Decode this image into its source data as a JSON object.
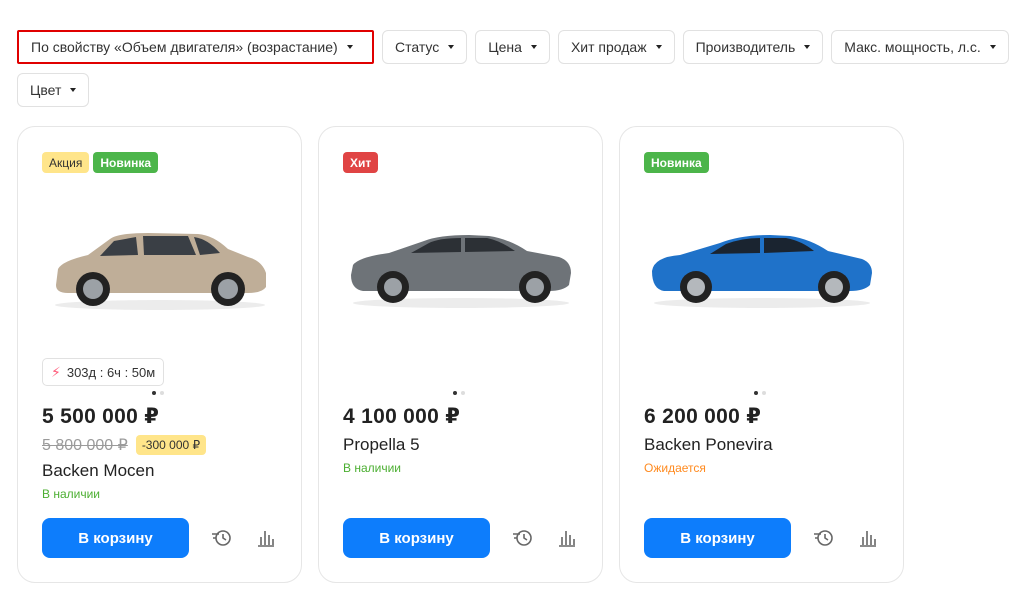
{
  "filters": [
    {
      "label": "По свойству «Объем двигателя» (возрастание)",
      "active": true
    },
    {
      "label": "Статус"
    },
    {
      "label": "Цена"
    },
    {
      "label": "Хит продаж"
    },
    {
      "label": "Производитель"
    },
    {
      "label": "Макс. мощность, л.с."
    },
    {
      "label": "Цвет"
    }
  ],
  "cards": [
    {
      "badges": [
        "Акция",
        "Новинка"
      ],
      "timer": "303д : 6ч : 50м",
      "price": "5 500 000 ₽",
      "old_price": "5 800 000 ₽",
      "discount": "-300 000 ₽",
      "name": "Backen Mocen",
      "status": "В наличии",
      "cart_label": "В корзину",
      "car_color": "#bfae98"
    },
    {
      "badges": [
        "Хит"
      ],
      "price": "4 100 000 ₽",
      "name": "Propella 5",
      "status": "В наличии",
      "cart_label": "В корзину",
      "car_color": "#6e7378"
    },
    {
      "badges": [
        "Новинка"
      ],
      "price": "6 200 000 ₽",
      "name": "Backen Ponevira",
      "status": "Ожидается",
      "cart_label": "В корзину",
      "car_color": "#1f72c9"
    }
  ],
  "colors": {
    "accent": "#0d7dfc",
    "in_stock": "#4caf32",
    "awaiting": "#ff8a1f",
    "hit": "#e04444",
    "new": "#4cb54a",
    "sale": "#ffe58a"
  },
  "icons": [
    "caret-down-icon",
    "lightning-icon",
    "history-icon",
    "compare-chart-icon",
    "car-image"
  ]
}
